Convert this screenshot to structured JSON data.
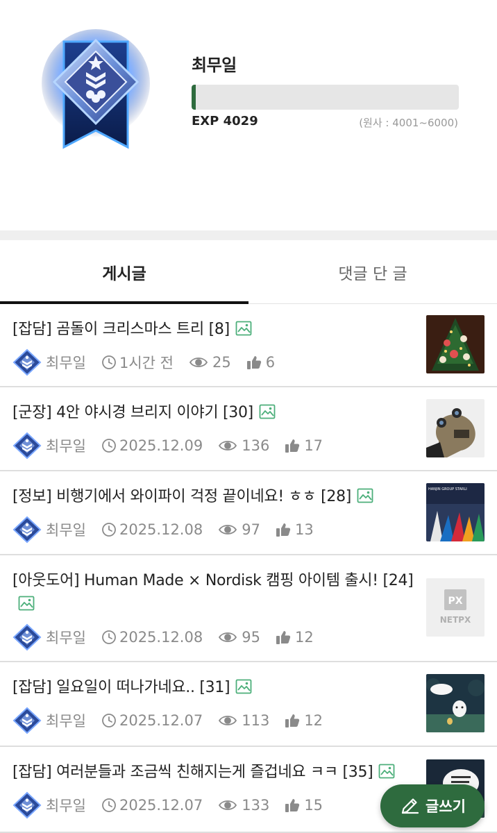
{
  "profile": {
    "username": "최무일",
    "exp_label": "EXP 4029",
    "exp_range": "(원사 : 4001~6000)",
    "exp_progress": 0.015
  },
  "tabs": [
    {
      "label": "게시글",
      "active": true
    },
    {
      "label": "댓글 단 글",
      "active": false
    }
  ],
  "posts": [
    {
      "title": "[잡담] 곰돌이 크리스마스 트리 [8]",
      "author": "최무일",
      "time": "1시간 전",
      "views": "25",
      "likes": "6",
      "thumb": "christmas-tree"
    },
    {
      "title": "[군장] 4안 야시경 브리지 이야기 [30]",
      "author": "최무일",
      "time": "2025.12.09",
      "views": "136",
      "likes": "17",
      "thumb": "night-vision"
    },
    {
      "title": "[정보] 비행기에서 와이파이 걱정 끝이네요! ㅎㅎ [28]",
      "author": "최무일",
      "time": "2025.12.08",
      "views": "97",
      "likes": "13",
      "thumb": "airplanes"
    },
    {
      "title": "[아웃도어] Human Made × Nordisk 캠핑 아이템 출시! [24]",
      "author": "최무일",
      "time": "2025.12.08",
      "views": "95",
      "likes": "12",
      "thumb": "netpx"
    },
    {
      "title": "[잡담] 일요일이 떠나가네요.. [31]",
      "author": "최무일",
      "time": "2025.12.07",
      "views": "113",
      "likes": "12",
      "thumb": "night-cartoon"
    },
    {
      "title": "[잡담] 여러분들과 조금씩 친해지는게 즐겁네요 ㅋㅋ [35]",
      "author": "최무일",
      "time": "2025.12.07",
      "views": "133",
      "likes": "15",
      "thumb": "chat-cartoon"
    }
  ],
  "thumb_text": {
    "netpx_logo": "NETPX",
    "netpx_mark": "PX",
    "airline_text": "HANJIN GROUP  STARLI"
  },
  "fab": {
    "label": "글쓰기"
  },
  "colors": {
    "accent": "#2e6b3e",
    "muted": "#8a8a8a",
    "image_icon": "#4caf7a"
  }
}
